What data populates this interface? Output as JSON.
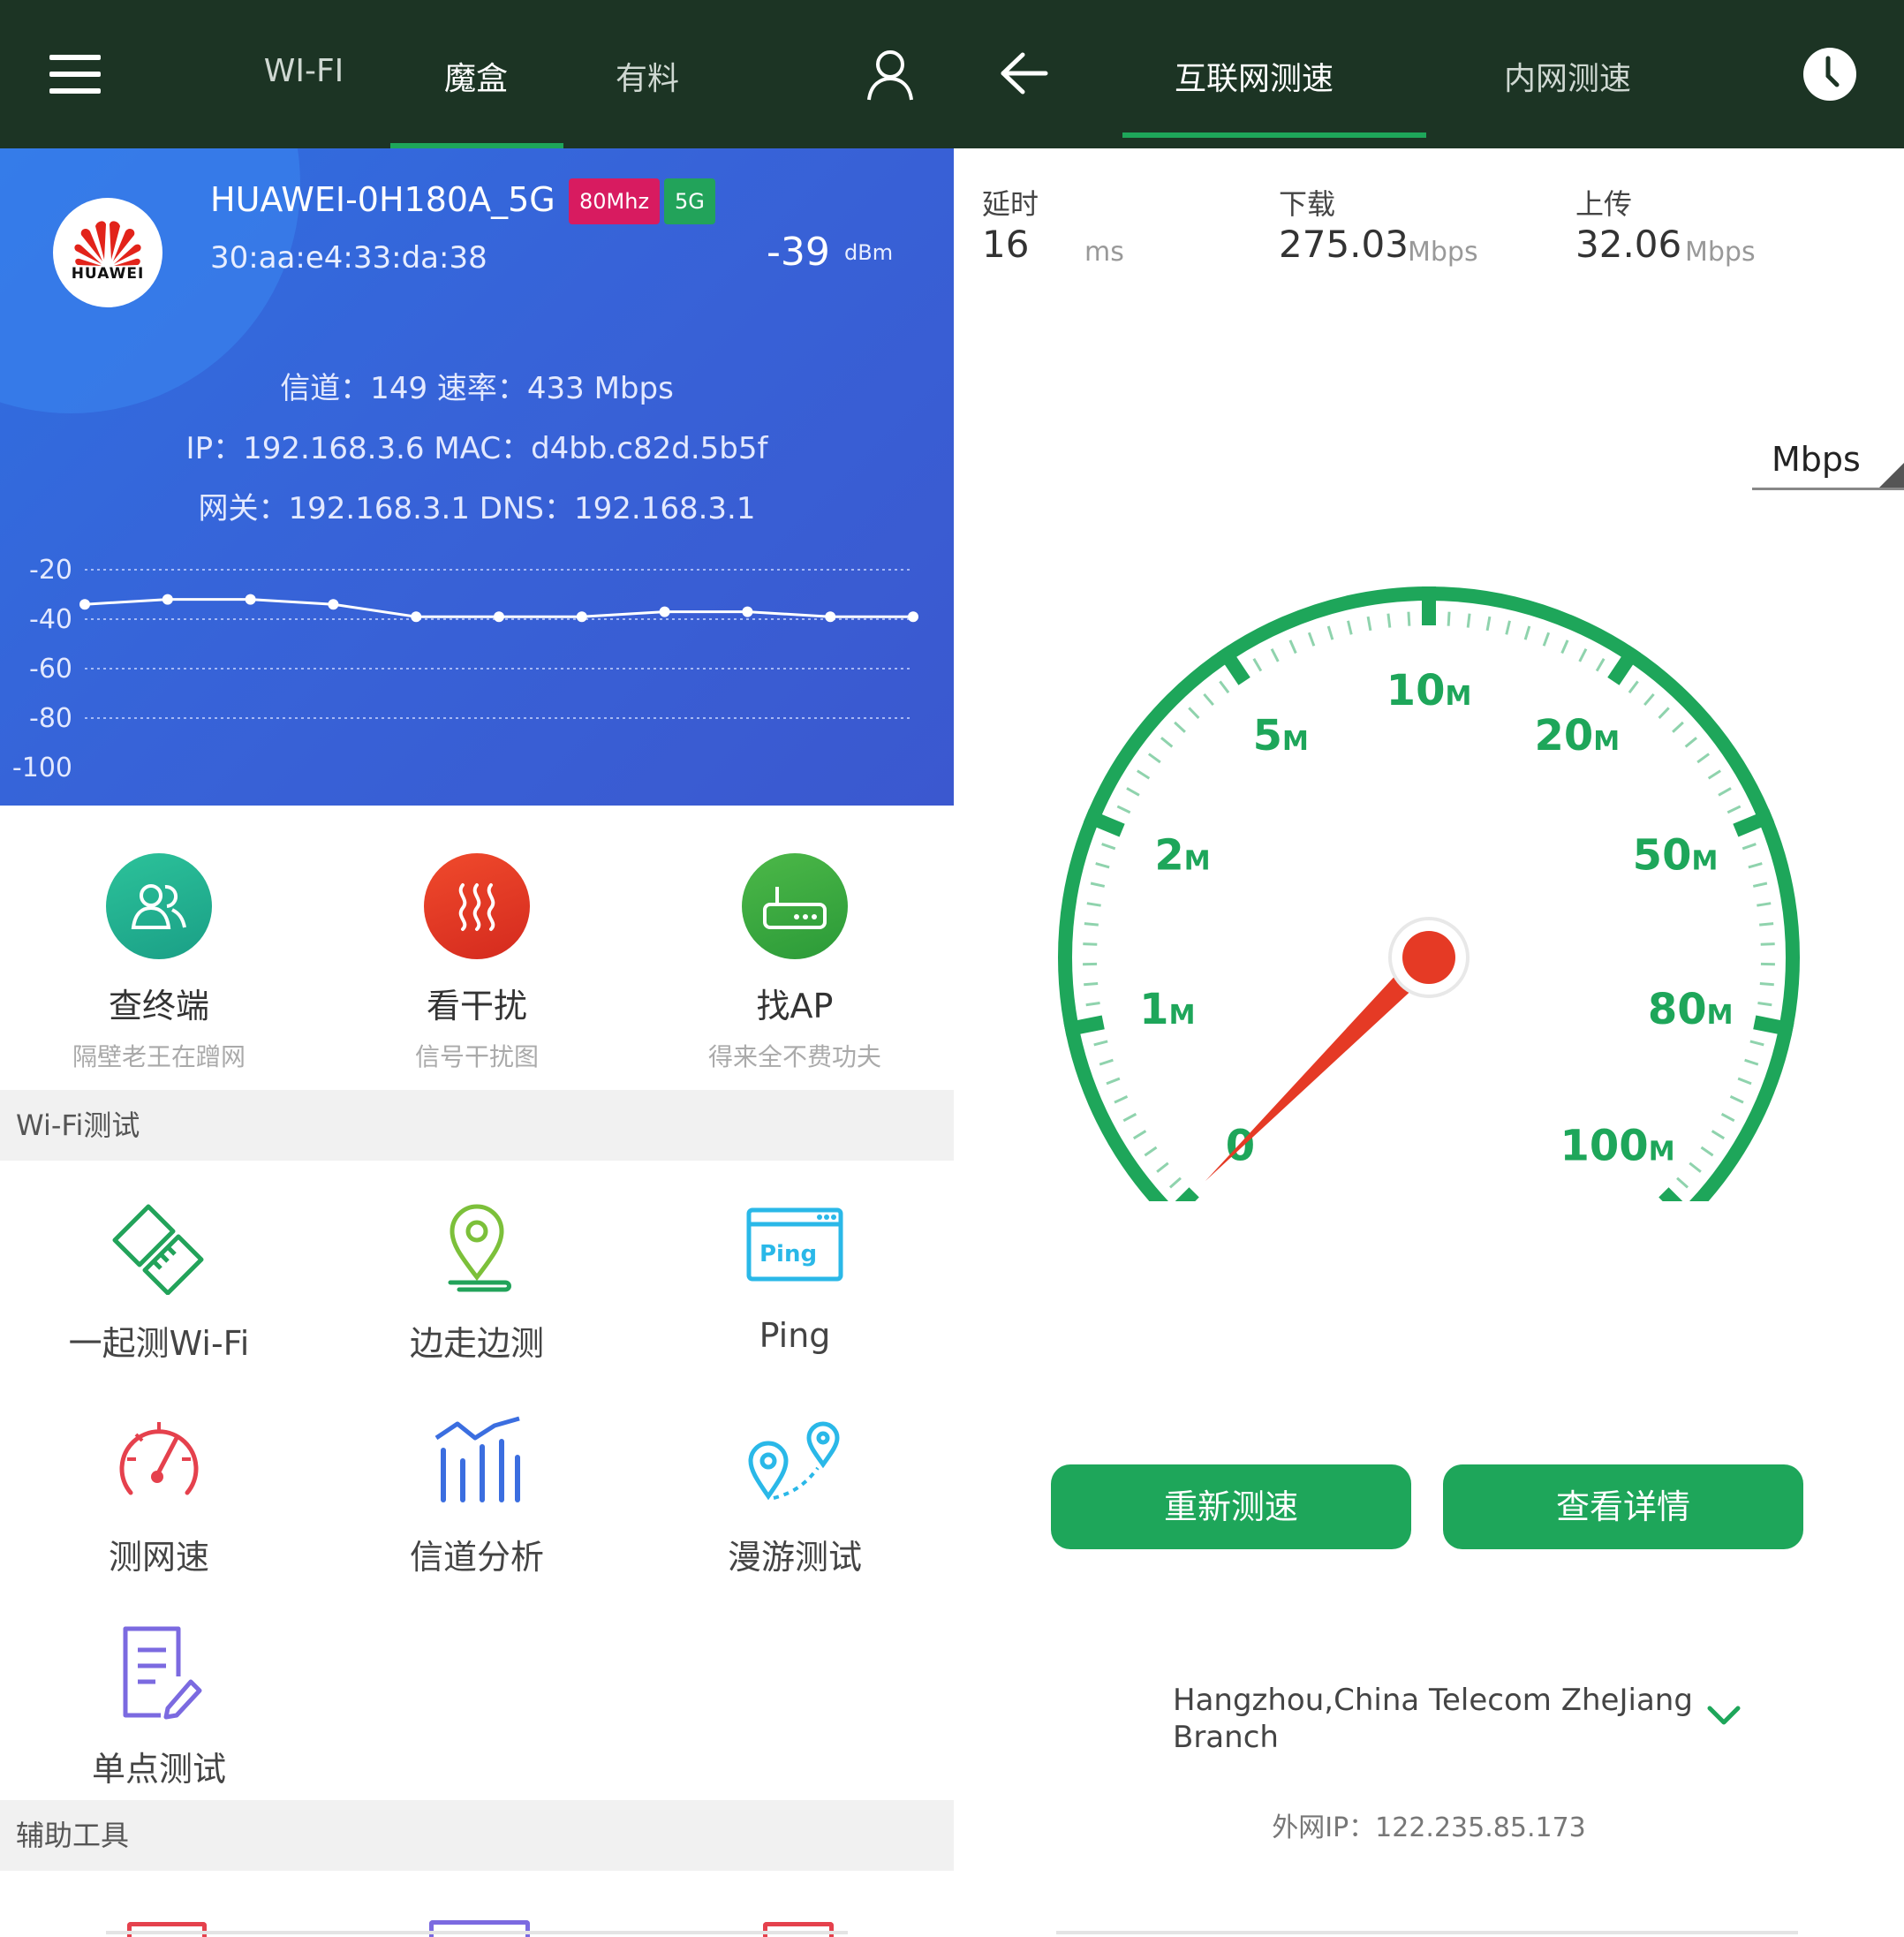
{
  "left": {
    "tabs": [
      {
        "label": "WI-FI",
        "active": false
      },
      {
        "label": "魔盒",
        "active": true
      },
      {
        "label": "有料",
        "active": false
      }
    ],
    "wifi": {
      "logo_text": "HUAWEI",
      "ssid": "HUAWEI-0H180A_5G",
      "badge_bandwidth": "80Mhz",
      "badge_band": "5G",
      "bssid": "30:aa:e4:33:da:38",
      "rssi": "-39",
      "rssi_unit": "dBm",
      "line1": "信道：149   速率：433 Mbps",
      "line2": "IP：192.168.3.6   MAC：d4bb.c82d.5b5f",
      "line3": "网关：192.168.3.1   DNS：192.168.3.1",
      "colors": {
        "bg": "#3763d8",
        "badge_bandwidth": "#d81b60",
        "badge_band": "#22a35a"
      }
    },
    "chart_data": {
      "type": "line",
      "y_ticks": [
        "-20",
        "-40",
        "-60",
        "-80",
        "-100"
      ],
      "ylim": [
        -100,
        -20
      ],
      "x": [
        1,
        2,
        3,
        4,
        5,
        6,
        7,
        8,
        9,
        10,
        11
      ],
      "values": [
        -34,
        -32,
        -32,
        -34,
        -39,
        -39,
        -39,
        -37,
        -37,
        -39,
        -39
      ],
      "grid": true
    },
    "features": [
      {
        "title": "查终端",
        "subtitle": "隔壁老王在蹭网",
        "icon": "users-icon",
        "color": "#22b38a"
      },
      {
        "title": "看干扰",
        "subtitle": "信号干扰图",
        "icon": "interference-icon",
        "color": "#e53a25"
      },
      {
        "title": "找AP",
        "subtitle": "得来全不费功夫",
        "icon": "router-icon",
        "color": "#3aa83e"
      }
    ],
    "section_wifi_test": "Wi-Fi测试",
    "tools": [
      {
        "label": "一起测Wi-Fi",
        "icon": "handshake-icon"
      },
      {
        "label": "边走边测",
        "icon": "location-pin-icon"
      },
      {
        "label": "Ping",
        "icon": "ping-icon",
        "icon_text": "Ping"
      },
      {
        "label": "测网速",
        "icon": "speedometer-icon"
      },
      {
        "label": "信道分析",
        "icon": "bar-chart-icon"
      },
      {
        "label": "漫游测试",
        "icon": "roaming-icon"
      },
      {
        "label": "单点测试",
        "icon": "document-edit-icon"
      }
    ],
    "section_aux_tools": "辅助工具"
  },
  "right": {
    "tabs": [
      {
        "label": "互联网测速",
        "active": true
      },
      {
        "label": "内网测速",
        "active": false
      }
    ],
    "stats": {
      "latency_label": "延时",
      "latency_value": "16",
      "latency_unit": "ms",
      "download_label": "下载",
      "download_value": "275.03",
      "download_unit": "Mbps",
      "upload_label": "上传",
      "upload_value": "32.06",
      "upload_unit": "Mbps"
    },
    "unit_selector": "Mbps",
    "gauge": {
      "labels": [
        {
          "num": "0",
          "suffix": ""
        },
        {
          "num": "1",
          "suffix": "M"
        },
        {
          "num": "2",
          "suffix": "M"
        },
        {
          "num": "5",
          "suffix": "M"
        },
        {
          "num": "10",
          "suffix": "M"
        },
        {
          "num": "20",
          "suffix": "M"
        },
        {
          "num": "50",
          "suffix": "M"
        },
        {
          "num": "80",
          "suffix": "M"
        },
        {
          "num": "100",
          "suffix": "M"
        }
      ],
      "needle_value": "0",
      "colors": {
        "arc": "#1ea65a",
        "needle": "#e53a25"
      }
    },
    "buttons": {
      "retest": "重新测速",
      "details": "查看详情"
    },
    "server": "Hangzhou,China Telecom ZheJiang Branch",
    "external_ip": "外网IP：122.235.85.173"
  }
}
